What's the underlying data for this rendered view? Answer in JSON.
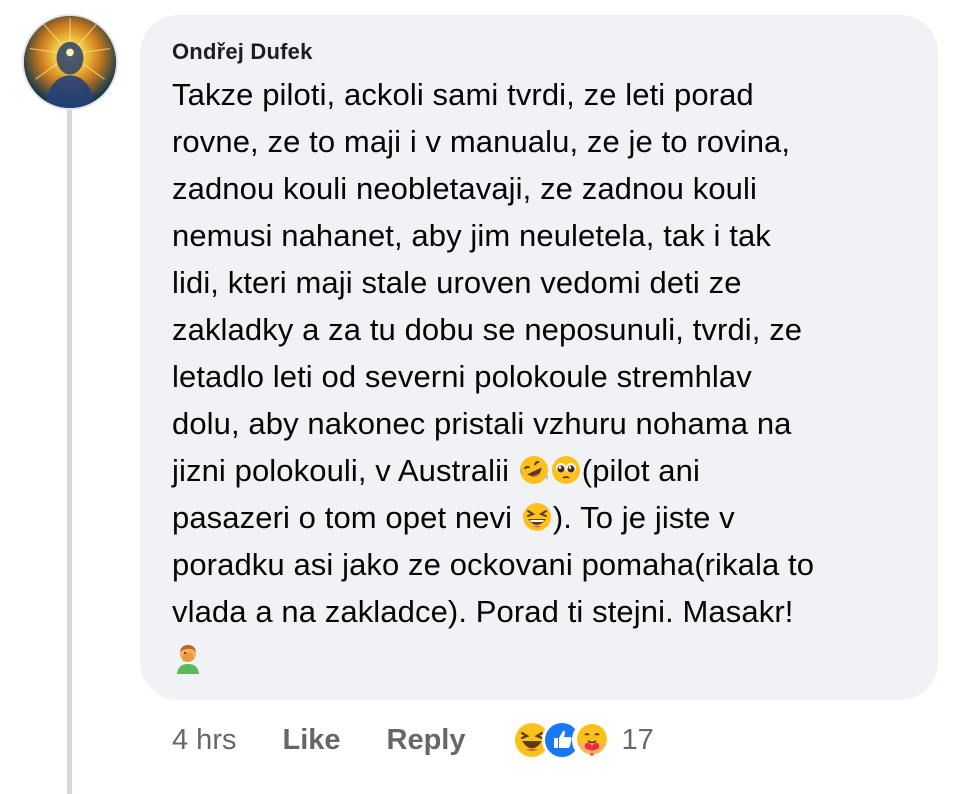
{
  "comment": {
    "author": "Ondřej Dufek",
    "lines": [
      "Takze piloti, ackoli sami tvrdi, ze leti porad",
      "rovne, ze to maji i v manualu, ze je to rovina,",
      "zadnou kouli neobletavaji, ze zadnou kouli",
      "nemusi nahanet, aby jim neuletela, tak i tak",
      "lidi, kteri maji stale uroven vedomi deti ze",
      "zakladky a za tu dobu se neposunuli, tvrdi, ze",
      "letadlo leti od severni polokoule stremhlav",
      "dolu, aby nakonec pristali vzhuru nohama na"
    ],
    "line9_text_a": "jizni polokouli, v Australii ",
    "line9_text_b": "(pilot ani",
    "line10_text_a": "pasazeri o tom opet nevi ",
    "line10_text_b": "). To je jiste v",
    "lines_tail": [
      "poradku asi jako ze ockovani pomaha(rikala to",
      "vlada a na zakladce). Porad ti stejni. Masakr!"
    ],
    "emojis": {
      "line9": [
        "rolling-on-floor-laughing-emoji",
        "pleading-face-emoji"
      ],
      "line10": [
        "grinning-squinting-face-emoji"
      ],
      "final": "man-facepalming-emoji"
    }
  },
  "actions": {
    "timestamp": "4 hrs",
    "like_label": "Like",
    "reply_label": "Reply",
    "reaction_count": "17",
    "reactions": [
      "haha",
      "like",
      "care"
    ]
  },
  "colors": {
    "bubble": "#f0f2f5",
    "text": "#050505",
    "muted": "#65676b",
    "like_blue": "#1877f2",
    "emoji_yellow": "#fcc21b"
  }
}
